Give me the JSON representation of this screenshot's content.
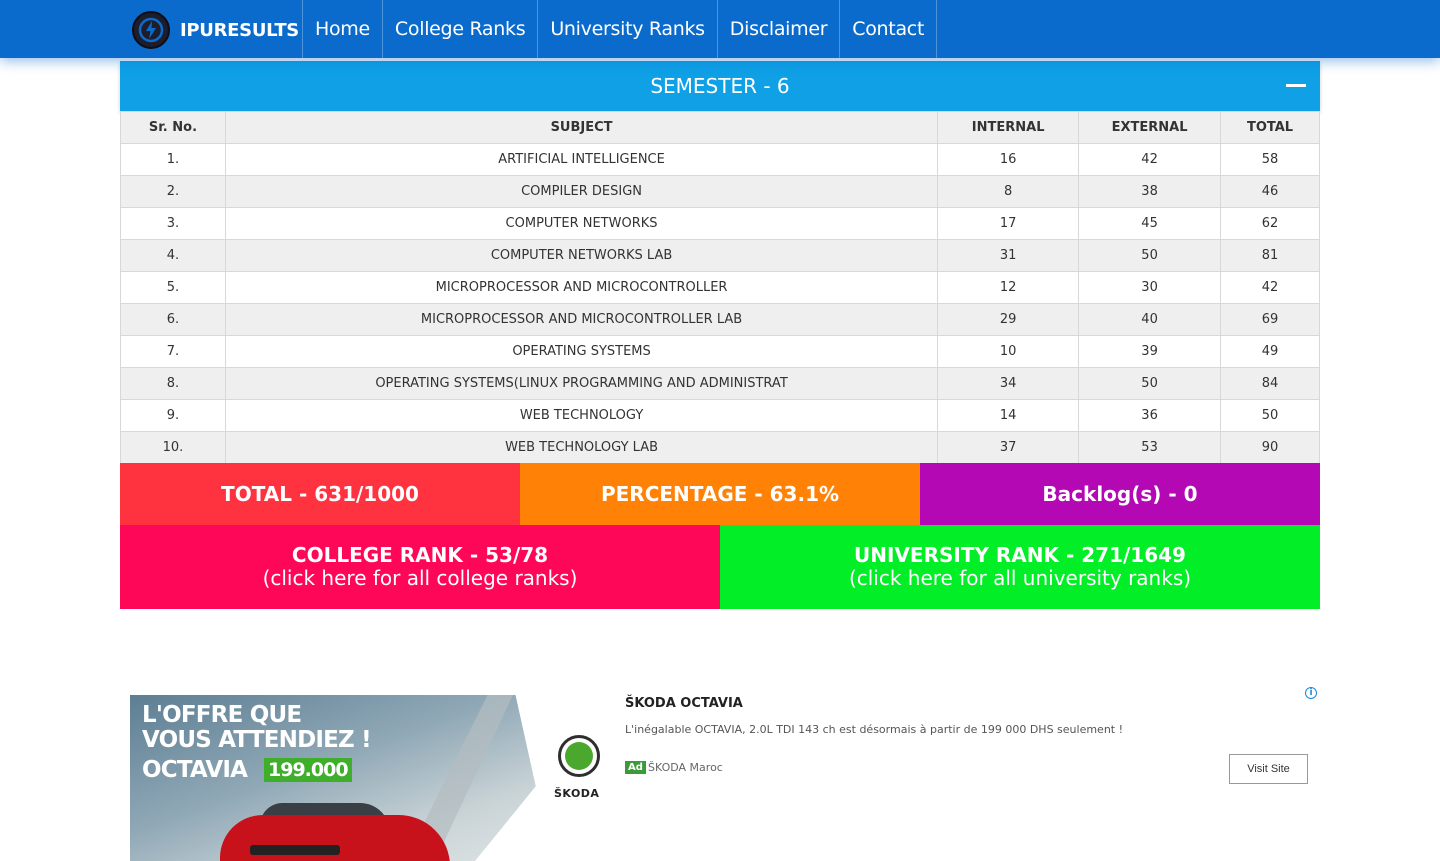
{
  "nav": {
    "brand": "IPURESULTS",
    "items": [
      "Home",
      "College Ranks",
      "University Ranks",
      "Disclaimer",
      "Contact"
    ]
  },
  "semester": {
    "title": "SEMESTER - 6"
  },
  "table": {
    "headers": [
      "Sr. No.",
      "SUBJECT",
      "INTERNAL",
      "EXTERNAL",
      "TOTAL"
    ],
    "rows": [
      [
        "1.",
        "ARTIFICIAL INTELLIGENCE",
        "16",
        "42",
        "58"
      ],
      [
        "2.",
        "COMPILER DESIGN",
        "8",
        "38",
        "46"
      ],
      [
        "3.",
        "COMPUTER NETWORKS",
        "17",
        "45",
        "62"
      ],
      [
        "4.",
        "COMPUTER NETWORKS LAB",
        "31",
        "50",
        "81"
      ],
      [
        "5.",
        "MICROPROCESSOR AND MICROCONTROLLER",
        "12",
        "30",
        "42"
      ],
      [
        "6.",
        "MICROPROCESSOR AND MICROCONTROLLER LAB",
        "29",
        "40",
        "69"
      ],
      [
        "7.",
        "OPERATING SYSTEMS",
        "10",
        "39",
        "49"
      ],
      [
        "8.",
        "OPERATING SYSTEMS(LINUX PROGRAMMING AND ADMINISTRAT",
        "34",
        "50",
        "84"
      ],
      [
        "9.",
        "WEB TECHNOLOGY",
        "14",
        "36",
        "50"
      ],
      [
        "10.",
        "WEB TECHNOLOGY LAB",
        "37",
        "53",
        "90"
      ]
    ]
  },
  "summary": {
    "total": "TOTAL - 631/1000",
    "percentage": "PERCENTAGE - 63.1%",
    "backlogs": "Backlog(s) - 0",
    "college_rank": "COLLEGE RANK - 53/78",
    "college_link": "(click here for all college ranks)",
    "university_rank": "UNIVERSITY RANK - 271/1649",
    "university_link": "(click here for all university ranks)"
  },
  "colors": {
    "navbar": "#0a6bcc",
    "semester_header": "#0fa0e6",
    "total": "#ff3340",
    "percentage": "#ff8206",
    "backlogs": "#b308b4",
    "college_rank": "#ff0758",
    "university_rank": "#02ee26"
  },
  "ad": {
    "headline_line1": "L'OFFRE QUE",
    "headline_line2": "VOUS ATTENDIEZ !",
    "headline_line3": "OCTAVIA",
    "price": "199.000",
    "logo_text": "ŠKODA",
    "title": "ŠKODA OCTAVIA",
    "description": "L'inégalable OCTAVIA, 2.0L TDI 143 ch est désormais à partir de 199 000 DHS seulement !",
    "badge": "Ad",
    "advertiser": "ŠKODA Maroc",
    "button": "Visit Site",
    "info_icon": "info-icon"
  }
}
